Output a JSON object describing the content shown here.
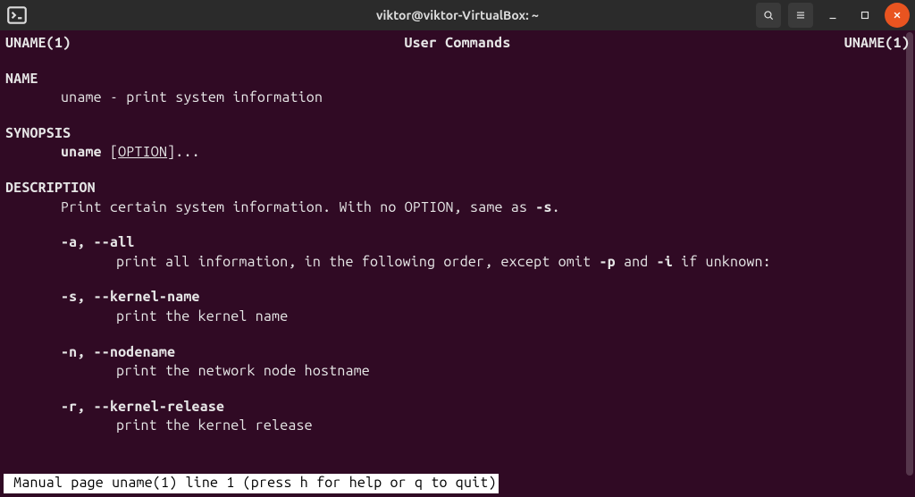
{
  "window": {
    "title": "viktor@viktor-VirtualBox: ~"
  },
  "man": {
    "header_left": "UNAME(1)",
    "header_center": "User Commands",
    "header_right": "UNAME(1)",
    "sections": {
      "name": {
        "heading": "NAME",
        "text": "uname - print system information"
      },
      "synopsis": {
        "heading": "SYNOPSIS",
        "cmd": "uname",
        "arg": "OPTION",
        "suffix": "]..."
      },
      "description": {
        "heading": "DESCRIPTION",
        "intro_pre": "Print certain system information.  With no OPTION, same as ",
        "intro_flag": "-s",
        "intro_post": ".",
        "options": [
          {
            "flags": "-a, --all",
            "desc_pre": "print all information, in the following order, except omit ",
            "desc_mid1": "-p",
            "desc_mid2": " and ",
            "desc_mid3": "-i",
            "desc_post": " if unknown:"
          },
          {
            "flags": "-s, --kernel-name",
            "desc": "print the kernel name"
          },
          {
            "flags": "-n, --nodename",
            "desc": "print the network node hostname"
          },
          {
            "flags": "-r, --kernel-release",
            "desc": "print the kernel release"
          }
        ]
      }
    },
    "status": " Manual page uname(1) line 1 (press h for help or q to quit)"
  },
  "icons": {
    "terminal": "terminal-icon",
    "search": "search-icon",
    "menu": "hamburger-icon",
    "minimize": "minimize-icon",
    "maximize": "maximize-icon",
    "close": "close-icon"
  }
}
